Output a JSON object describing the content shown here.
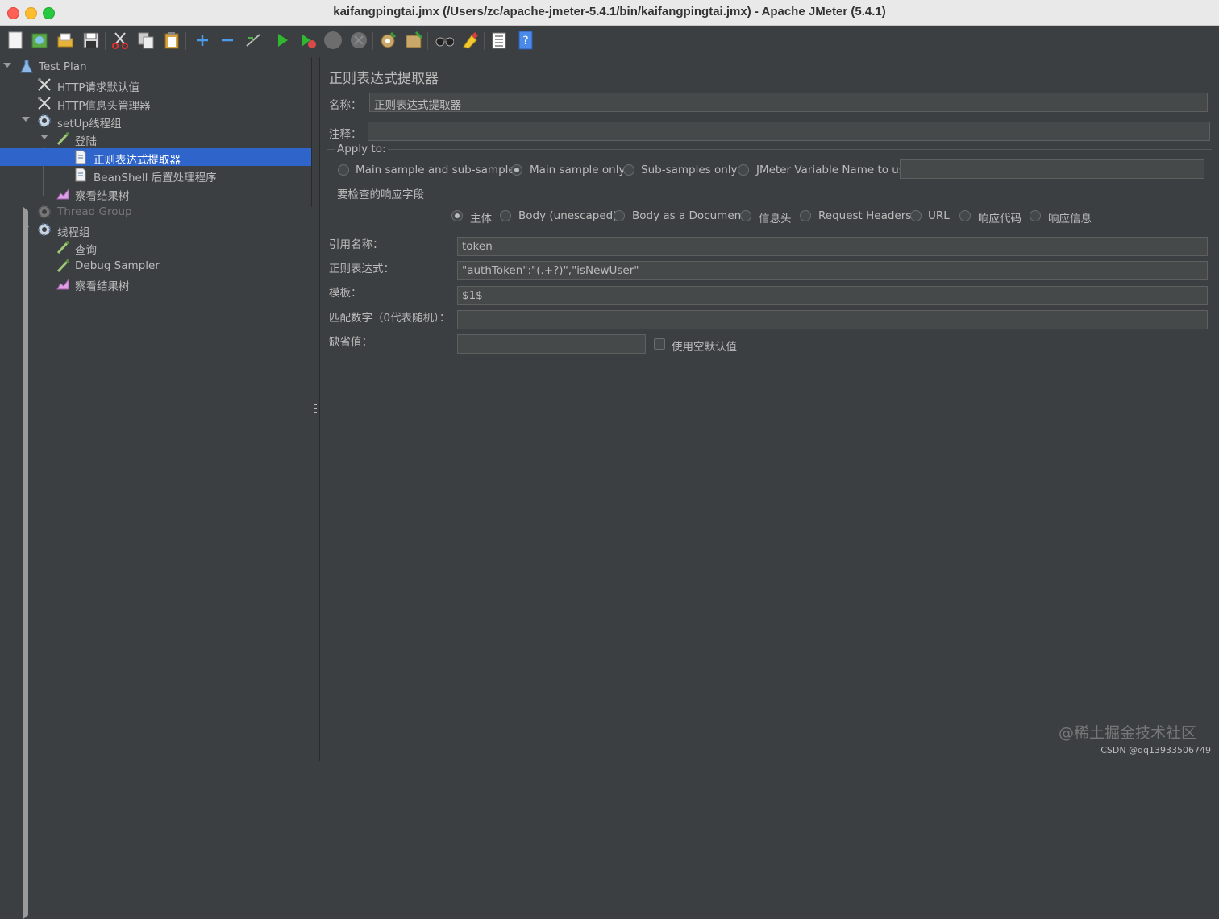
{
  "window": {
    "title": "kaifangpingtai.jmx (/Users/zc/apache-jmeter-5.4.1/bin/kaifangpingtai.jmx) - Apache JMeter (5.4.1)"
  },
  "toolbar": {
    "buttons": [
      "new-icon",
      "templates-icon",
      "open-icon",
      "save-icon",
      "cut-icon",
      "copy-icon",
      "paste-icon",
      "expand-icon",
      "collapse-icon",
      "toggle-icon",
      "start-icon",
      "start-no-pause-icon",
      "stop-icon",
      "shutdown-icon",
      "clear-icon",
      "clear-all-icon",
      "search-icon",
      "reset-search-icon",
      "function-helper-icon",
      "help-icon"
    ]
  },
  "tree": {
    "items": [
      {
        "label": "Test Plan",
        "icon": "flask-icon"
      },
      {
        "label": "HTTP请求默认值",
        "icon": "wrench-icon"
      },
      {
        "label": "HTTP信息头管理器",
        "icon": "wrench-icon"
      },
      {
        "label": "setUp线程组",
        "icon": "gear-icon"
      },
      {
        "label": "登陆",
        "icon": "pipette-icon"
      },
      {
        "label": "正则表达式提取器",
        "icon": "document-icon"
      },
      {
        "label": "BeanShell 后置处理程序",
        "icon": "document-icon"
      },
      {
        "label": "察看结果树",
        "icon": "chart-icon"
      },
      {
        "label": "Thread Group",
        "icon": "gear-icon"
      },
      {
        "label": "线程组",
        "icon": "gear-icon"
      },
      {
        "label": "查询",
        "icon": "pipette-icon"
      },
      {
        "label": "Debug Sampler",
        "icon": "pipette-icon"
      },
      {
        "label": "察看结果树",
        "icon": "chart-icon"
      }
    ],
    "selected_label": "正则表达式提取器"
  },
  "panel": {
    "title": "正则表达式提取器",
    "name_label": "名称：",
    "name_value": "正则表达式提取器",
    "comment_label": "注释：",
    "comment_value": "",
    "apply_to": {
      "label": "Apply to:",
      "options": [
        "Main sample and sub-samples",
        "Main sample only",
        "Sub-samples only",
        "JMeter Variable Name to use"
      ],
      "selected": "Main sample only",
      "variable_value": ""
    },
    "field_check": {
      "label": "要检查的响应字段",
      "options": [
        "主体",
        "Body (unescaped)",
        "Body as a Document",
        "信息头",
        "Request Headers",
        "URL",
        "响应代码",
        "响应信息"
      ],
      "selected": "主体"
    },
    "ref_name_label": "引用名称：",
    "ref_name_value": "token",
    "regex_label": "正则表达式：",
    "regex_value": "\"authToken\":\"(.+?)\",\"isNewUser\"",
    "template_label": "模板：",
    "template_value": "$1$",
    "match_no_label": "匹配数字（0代表随机）：",
    "match_no_value": "",
    "default_label": "缺省值：",
    "default_value": "",
    "use_empty_label": "使用空默认值",
    "use_empty_checked": false
  },
  "watermark": {
    "text": "@稀土掘金技术社区",
    "credit": "CSDN @qq13933506749"
  }
}
